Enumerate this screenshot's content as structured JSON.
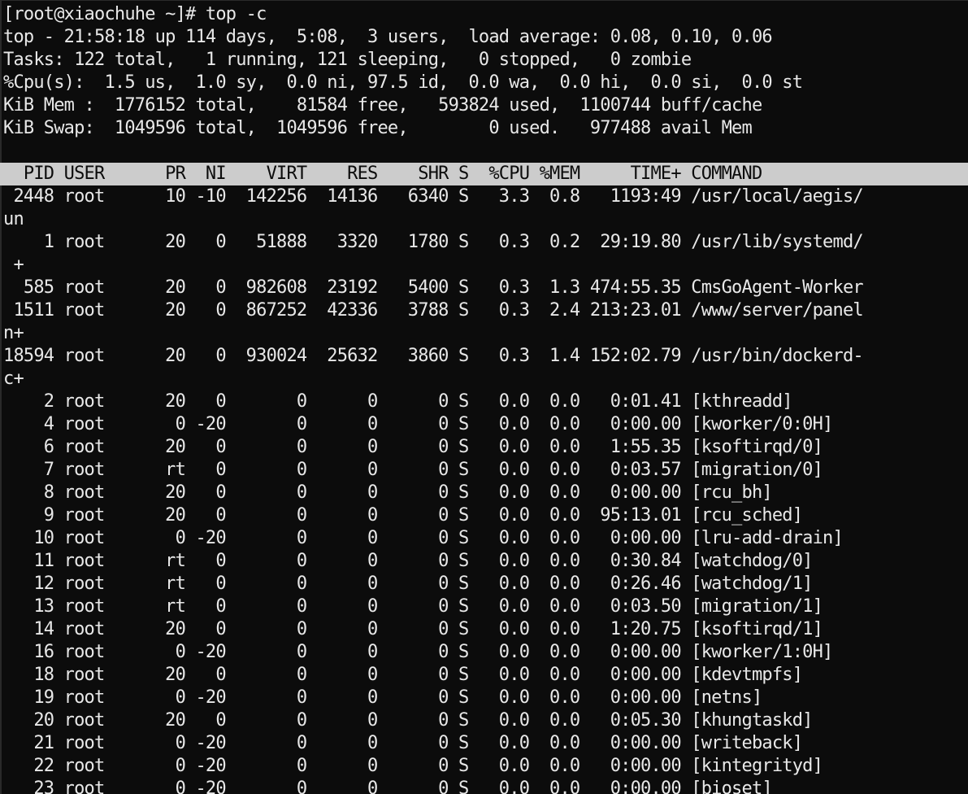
{
  "terminal": {
    "prompt_line": "[root@xiaochuhe ~]# top -c",
    "summary": [
      "top - 21:58:18 up 114 days,  5:08,  3 users,  load average: 0.08, 0.10, 0.06",
      "Tasks: 122 total,   1 running, 121 sleeping,   0 stopped,   0 zombie",
      "%Cpu(s):  1.5 us,  1.0 sy,  0.0 ni, 97.5 id,  0.0 wa,  0.0 hi,  0.0 si,  0.0 st",
      "KiB Mem :  1776152 total,    81584 free,   593824 used,  1100744 buff/cache",
      "KiB Swap:  1049596 total,  1049596 free,        0 used.   977488 avail Mem"
    ],
    "blank_line": "",
    "table_header": "  PID USER      PR  NI    VIRT    RES    SHR S  %CPU %MEM     TIME+ COMMAND",
    "rows": [
      " 2448 root      10 -10  142256  14136   6340 S   3.3  0.8   1193:49 /usr/local/aegis/",
      "un",
      "    1 root      20   0   51888   3320   1780 S   0.3  0.2  29:19.80 /usr/lib/systemd/",
      " +",
      "  585 root      20   0  982608  23192   5400 S   0.3  1.3 474:55.35 CmsGoAgent-Worker",
      " 1511 root      20   0  867252  42336   3788 S   0.3  2.4 213:23.01 /www/server/panel",
      "n+",
      "18594 root      20   0  930024  25632   3860 S   0.3  1.4 152:02.79 /usr/bin/dockerd-",
      "c+",
      "    2 root      20   0       0      0      0 S   0.0  0.0   0:01.41 [kthreadd]",
      "    4 root       0 -20       0      0      0 S   0.0  0.0   0:00.00 [kworker/0:0H]",
      "    6 root      20   0       0      0      0 S   0.0  0.0   1:55.35 [ksoftirqd/0]",
      "    7 root      rt   0       0      0      0 S   0.0  0.0   0:03.57 [migration/0]",
      "    8 root      20   0       0      0      0 S   0.0  0.0   0:00.00 [rcu_bh]",
      "    9 root      20   0       0      0      0 S   0.0  0.0  95:13.01 [rcu_sched]",
      "   10 root       0 -20       0      0      0 S   0.0  0.0   0:00.00 [lru-add-drain]",
      "   11 root      rt   0       0      0      0 S   0.0  0.0   0:30.84 [watchdog/0]",
      "   12 root      rt   0       0      0      0 S   0.0  0.0   0:26.46 [watchdog/1]",
      "   13 root      rt   0       0      0      0 S   0.0  0.0   0:03.50 [migration/1]",
      "   14 root      20   0       0      0      0 S   0.0  0.0   1:20.75 [ksoftirqd/1]",
      "   16 root       0 -20       0      0      0 S   0.0  0.0   0:00.00 [kworker/1:0H]",
      "   18 root      20   0       0      0      0 S   0.0  0.0   0:00.00 [kdevtmpfs]",
      "   19 root       0 -20       0      0      0 S   0.0  0.0   0:00.00 [netns]",
      "   20 root      20   0       0      0      0 S   0.0  0.0   0:05.30 [khungtaskd]",
      "   21 root       0 -20       0      0      0 S   0.0  0.0   0:00.00 [writeback]",
      "   22 root       0 -20       0      0      0 S   0.0  0.0   0:00.00 [kintegrityd]",
      "   23 root       0 -20       0      0      0 S   0.0  0.0   0:00.00 [bioset]"
    ]
  },
  "colors": {
    "background": "#0c0c0c",
    "foreground": "#e8e8e8",
    "header_bar": "#cccccc",
    "header_text": "#0c0c0c"
  }
}
